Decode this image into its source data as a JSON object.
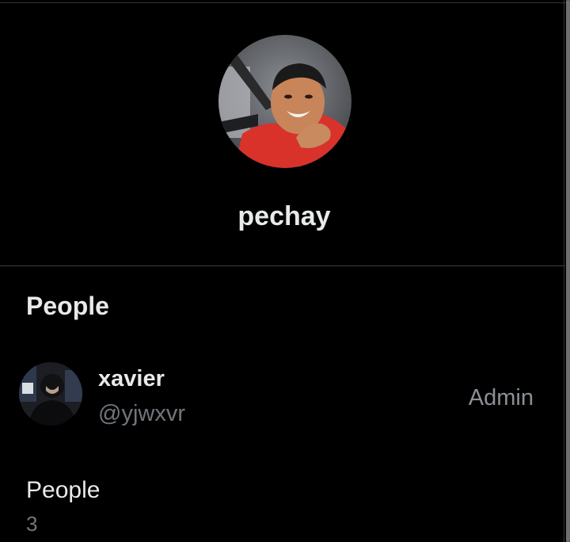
{
  "group": {
    "name": "pechay",
    "avatar_icon": "group-avatar-photo"
  },
  "people_section": {
    "title": "People",
    "members": [
      {
        "name": "xavier",
        "handle": "@yjwxvr",
        "role": "Admin",
        "avatar_icon": "user-avatar-photo"
      }
    ]
  },
  "stats": {
    "people_label": "People",
    "people_count": "3"
  },
  "colors": {
    "background": "#000000",
    "primary_text": "#e7e9ea",
    "secondary_text": "#71767b",
    "divider": "#3a3d40"
  }
}
